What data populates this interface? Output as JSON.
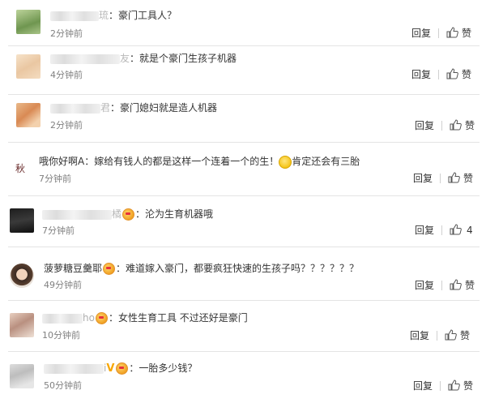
{
  "comments": [
    {
      "name_visible": "",
      "name_tail": "琉",
      "text": "：豪门工具人？",
      "time": "2分钟前",
      "reply": "回复",
      "like": "赞"
    },
    {
      "name_visible": "",
      "name_tail": "友",
      "text": "：就是个豪门生孩子机器",
      "time": "4分钟前",
      "reply": "回复",
      "like": "赞"
    },
    {
      "name_visible": "",
      "name_tail": "君",
      "text": "：豪门媳妇就是造人机器",
      "time": "2分钟前",
      "reply": "回复",
      "like": "赞"
    },
    {
      "name_visible": "哦你好啊A",
      "name_tail": "",
      "text": "：嫁给有钱人的都是这样一个连着一个的生！",
      "text2": "肯定还会有三胎",
      "time": "7分钟前",
      "reply": "回复",
      "like": "赞",
      "avatar_text": "秋"
    },
    {
      "name_visible": "",
      "name_tail": "橘",
      "text": "：沦为生育机器哦",
      "time": "7分钟前",
      "reply": "回复",
      "like": "4"
    },
    {
      "name_visible": "菠萝糖豆羹耶",
      "name_tail": "",
      "text": "：难道嫁入豪门，都要疯狂快速的生孩子吗？？？？？？",
      "time": "49分钟前",
      "reply": "回复",
      "like": "赞"
    },
    {
      "name_visible": "",
      "name_tail": "ho",
      "text": "：女性生育工具 不过还好是豪门",
      "time": "10分钟前",
      "reply": "回复",
      "like": "赞"
    },
    {
      "name_visible": "",
      "name_tail": "i",
      "text": "：一胎多少钱？",
      "time": "50分钟前",
      "reply": "回复",
      "like": "赞"
    }
  ]
}
